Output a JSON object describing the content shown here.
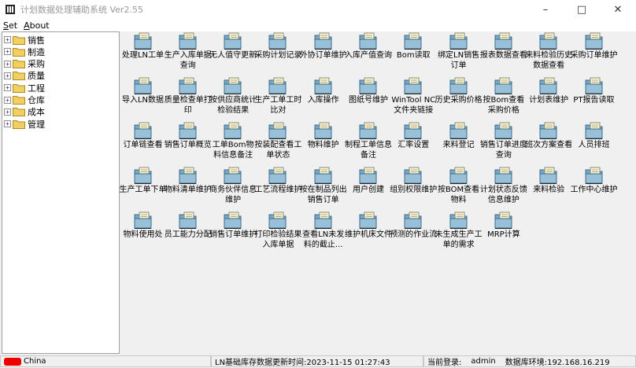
{
  "window": {
    "title": "计划数据处理辅助系统 Ver2.55"
  },
  "menu": [
    {
      "label": "Set",
      "key": "S"
    },
    {
      "label": "About",
      "key": "A"
    }
  ],
  "tree": [
    {
      "label": "销售"
    },
    {
      "label": "制造"
    },
    {
      "label": "采购"
    },
    {
      "label": "质量"
    },
    {
      "label": "工程"
    },
    {
      "label": "仓库"
    },
    {
      "label": "成本"
    },
    {
      "label": "管理"
    }
  ],
  "tiles": [
    {
      "label": "处理LN工单"
    },
    {
      "label": "生产入库单据查询"
    },
    {
      "label": "无人值守更新"
    },
    {
      "label": "采购计划记录"
    },
    {
      "label": "外协订单维护"
    },
    {
      "label": "入库产值查询"
    },
    {
      "label": "Bom读取"
    },
    {
      "label": "绑定LN销售订单"
    },
    {
      "label": "报表数据查看"
    },
    {
      "label": "来料检验历史数据查看"
    },
    {
      "label": "采购订单维护"
    },
    {
      "label": "导入LN数据"
    },
    {
      "label": "质量检查单打印"
    },
    {
      "label": "按供应商统计检验结果"
    },
    {
      "label": "生产工单工时比对"
    },
    {
      "label": "入库操作"
    },
    {
      "label": "图纸号维护"
    },
    {
      "label": "WinTool NC文件夹链接"
    },
    {
      "label": "历史采购价格"
    },
    {
      "label": "按Bom查看采购价格"
    },
    {
      "label": "计划表维护"
    },
    {
      "label": "PT报告读取"
    },
    {
      "label": "订单链查看"
    },
    {
      "label": "销售订单概览"
    },
    {
      "label": "工单Bom物料信息备注"
    },
    {
      "label": "按装配查看工单状态"
    },
    {
      "label": "物料维护"
    },
    {
      "label": "制程工单信息备注"
    },
    {
      "label": "汇率设置"
    },
    {
      "label": "来料登记"
    },
    {
      "label": "销售订单进度查询"
    },
    {
      "label": "班次方案查看"
    },
    {
      "label": "人员排班"
    },
    {
      "label": "生产工单下单"
    },
    {
      "label": "物料清单维护"
    },
    {
      "label": "商务伙伴信息维护"
    },
    {
      "label": "工艺流程维护"
    },
    {
      "label": "按在制品列出销售订单"
    },
    {
      "label": "用户创建"
    },
    {
      "label": "组别权限维护"
    },
    {
      "label": "按BOM查看物料"
    },
    {
      "label": "计划状态反馈信息维护"
    },
    {
      "label": "来料检验"
    },
    {
      "label": "工作中心维护"
    },
    {
      "label": "物料使用处"
    },
    {
      "label": "员工能力分配"
    },
    {
      "label": "销售订单维护"
    },
    {
      "label": "打印检验结果入库单据"
    },
    {
      "label": "查看LN未发料的截止..."
    },
    {
      "label": "维护机床文件"
    },
    {
      "label": "预测的作业流"
    },
    {
      "label": "未生成生产工单的需求"
    },
    {
      "label": "MRP计算"
    }
  ],
  "status": {
    "locale": "China",
    "update_time": "LN基础库存数据更新时间:2023-11-15 01:27:43",
    "login_label": "当前登录:",
    "login_user": "admin",
    "db_env": "数据库环境:192.168.16.219"
  },
  "colors": {
    "folder": "#f0d060",
    "tile_folder": "#78a8c8",
    "tile_doc": "#fff8c0"
  }
}
